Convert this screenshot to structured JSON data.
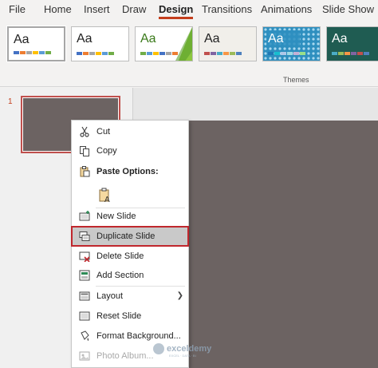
{
  "ribbon_tabs": [
    {
      "label": "File"
    },
    {
      "label": "Home"
    },
    {
      "label": "Insert"
    },
    {
      "label": "Draw"
    },
    {
      "label": "Design",
      "active": true
    },
    {
      "label": "Transitions"
    },
    {
      "label": "Animations"
    },
    {
      "label": "Slide Show"
    }
  ],
  "themes": {
    "group_label": "Themes",
    "items": [
      {
        "text": "Aa",
        "bg": "#ffffff",
        "fg": "#222222",
        "bars": [
          "#4472c4",
          "#ed7d31",
          "#a5a5a5",
          "#ffc000",
          "#5b9bd5",
          "#70ad47"
        ]
      },
      {
        "text": "Aa",
        "bg": "#ffffff",
        "fg": "#222222",
        "bars": [
          "#4472c4",
          "#ed7d31",
          "#a5a5a5",
          "#ffc000",
          "#5b9bd5",
          "#70ad47"
        ]
      },
      {
        "text": "Aa",
        "bg": "#ffffff",
        "fg": "#3a7a1a",
        "bars": [
          "#70ad47",
          "#5b9bd5",
          "#ffc000",
          "#4472c4",
          "#a5a5a5",
          "#ed7d31"
        ]
      },
      {
        "text": "Aa",
        "bg": "#f1efea",
        "fg": "#222222",
        "bars": [
          "#c0504d",
          "#8064a2",
          "#4bacc6",
          "#f79646",
          "#9bbb59",
          "#4f81bd"
        ]
      },
      {
        "text": "Aa",
        "bg": "#2e8fbf",
        "fg": "#ffffff",
        "bars": [
          "#1f77b4",
          "#17becf",
          "#aec7e8",
          "#9edae5",
          "#c5b0d5",
          "#98df8a"
        ]
      },
      {
        "text": "Aa",
        "bg": "#1f5c52",
        "fg": "#ffffff",
        "bars": [
          "#4bacc6",
          "#9bbb59",
          "#f79646",
          "#8064a2",
          "#c0504d",
          "#4f81bd"
        ]
      }
    ]
  },
  "thumbnail": {
    "slide_number": "1"
  },
  "context_menu": {
    "items": [
      {
        "label": "Cut",
        "icon": "scissors-icon"
      },
      {
        "label": "Copy",
        "icon": "copy-icon"
      },
      {
        "label": "Paste Options:",
        "icon": "paste-icon"
      },
      {
        "label": "New Slide",
        "icon": "new-slide-icon"
      },
      {
        "label": "Duplicate Slide",
        "icon": "duplicate-slide-icon"
      },
      {
        "label": "Delete Slide",
        "icon": "delete-slide-icon"
      },
      {
        "label": "Add Section",
        "icon": "add-section-icon"
      },
      {
        "label": "Layout",
        "icon": "layout-icon"
      },
      {
        "label": "Reset Slide",
        "icon": "reset-slide-icon"
      },
      {
        "label": "Format Background...",
        "icon": "format-background-icon"
      },
      {
        "label": "Photo Album...",
        "icon": "photo-album-icon"
      }
    ],
    "paste_option_icon": "paste-keep-text-only-icon"
  },
  "watermark": {
    "brand": "exceldemy",
    "tagline": "EXCEL · DATA · BI"
  }
}
